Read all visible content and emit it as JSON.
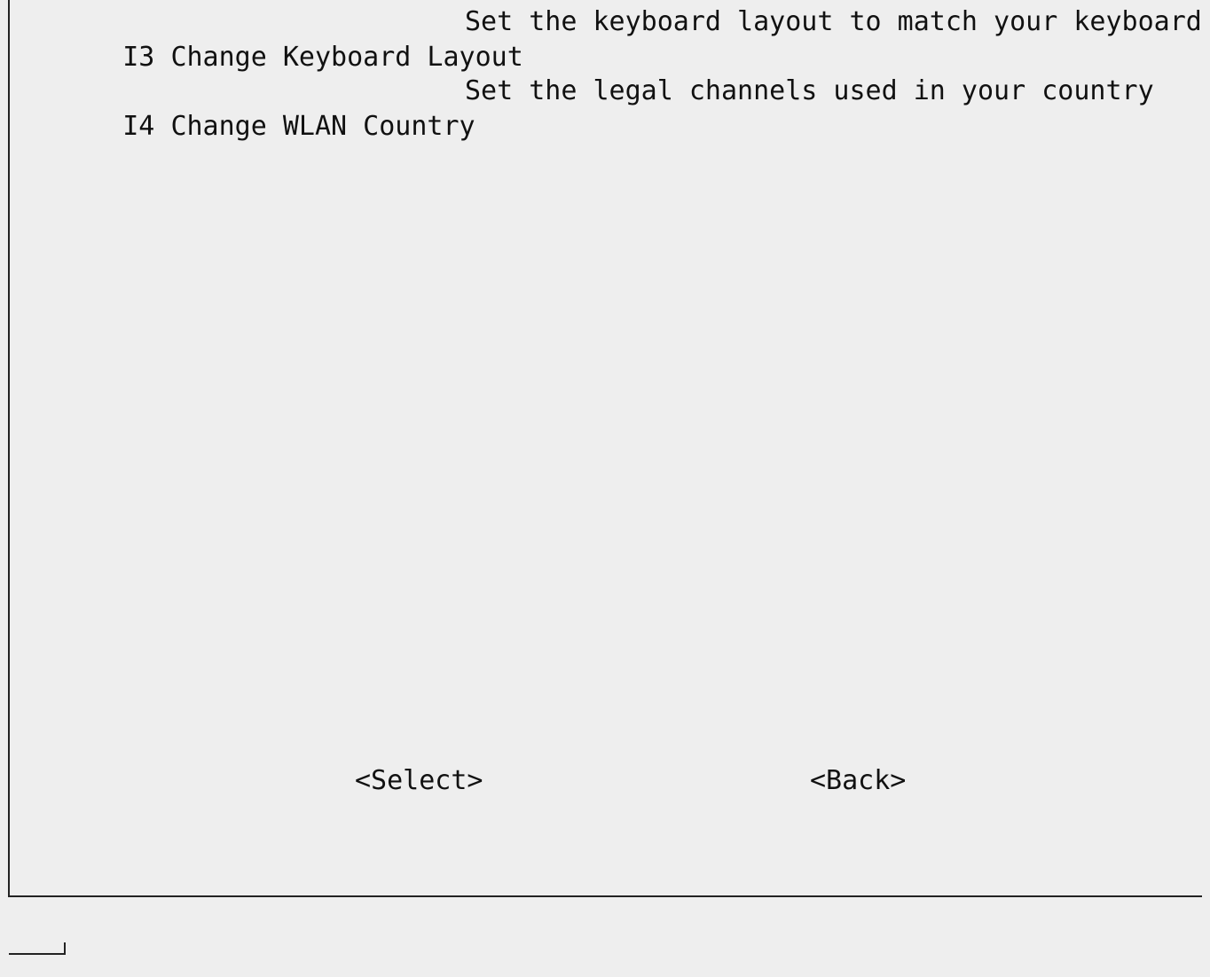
{
  "menu": {
    "items": [
      {
        "key": "I3",
        "label": "Change Keyboard Layout",
        "description": "Set the keyboard layout to match your keyboard"
      },
      {
        "key": "I4",
        "label": "Change WLAN Country",
        "description": "Set the legal channels used in your country"
      }
    ]
  },
  "buttons": {
    "select_label": "<Select>",
    "back_label": "<Back>"
  },
  "colors": {
    "background": "#eeeeee",
    "text": "#111111",
    "border": "#222222"
  }
}
